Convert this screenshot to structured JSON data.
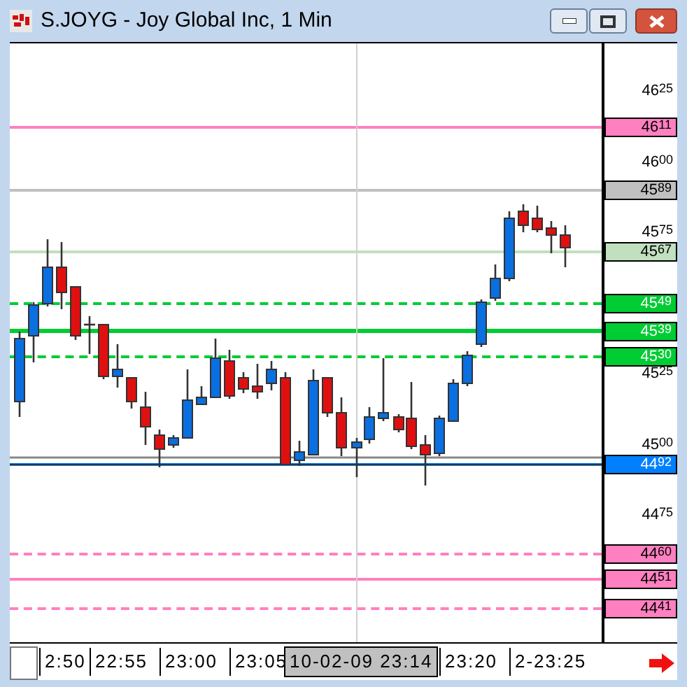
{
  "window": {
    "title": "S.JOYG - Joy Global Inc, 1 Min"
  },
  "price_axis": [
    {
      "kind": "tick",
      "label": "46$^{25}$"
    },
    {
      "kind": "level",
      "label": "46$^{11}$",
      "color": "#ff80c0",
      "dashed": false,
      "thick": false
    },
    {
      "kind": "tick",
      "label": "46$^{00}$"
    },
    {
      "kind": "level",
      "label": "45$^{89}$",
      "color": "#c0c0c0",
      "dashed": false,
      "thick": false
    },
    {
      "kind": "tick",
      "label": "45$^{75}$"
    },
    {
      "kind": "level",
      "label": "45$^{67}$",
      "color": "#c0e0c0",
      "dashed": false,
      "thick": false
    },
    {
      "kind": "level",
      "label": "45$^{49}$",
      "color": "#00cc33",
      "dashed": true,
      "thick": false
    },
    {
      "kind": "level",
      "label": "45$^{39}$",
      "color": "#00cc33",
      "dashed": false,
      "thick": true
    },
    {
      "kind": "level",
      "label": "45$^{30}$",
      "color": "#00cc33",
      "dashed": true,
      "thick": false
    },
    {
      "kind": "tick",
      "label": "45$^{25}$"
    },
    {
      "kind": "tick",
      "label": "45$^{00}$"
    },
    {
      "kind": "level",
      "label": "44$^{92}$",
      "color": "#0080ff",
      "dashed": false,
      "thick": false
    },
    {
      "kind": "tick",
      "label": "44$^{75}$"
    },
    {
      "kind": "level",
      "label": "44$^{60}$",
      "color": "#ff80c0",
      "dashed": true,
      "thick": false
    },
    {
      "kind": "level",
      "label": "44$^{51}$",
      "color": "#ff80c0",
      "dashed": false,
      "thick": false
    },
    {
      "kind": "level",
      "label": "44$^{41}$",
      "color": "#ff80c0",
      "dashed": true,
      "thick": false
    }
  ],
  "time_axis": [
    {
      "label": "2:50",
      "selected": false
    },
    {
      "label": "22:55",
      "selected": false
    },
    {
      "label": "23:00",
      "selected": false
    },
    {
      "label": "23:05",
      "selected": false
    },
    {
      "label": "10-02-09  23:14",
      "selected": true
    },
    {
      "label": "23:20",
      "selected": false
    },
    {
      "label": "2-23:25",
      "selected": false
    }
  ]
}
